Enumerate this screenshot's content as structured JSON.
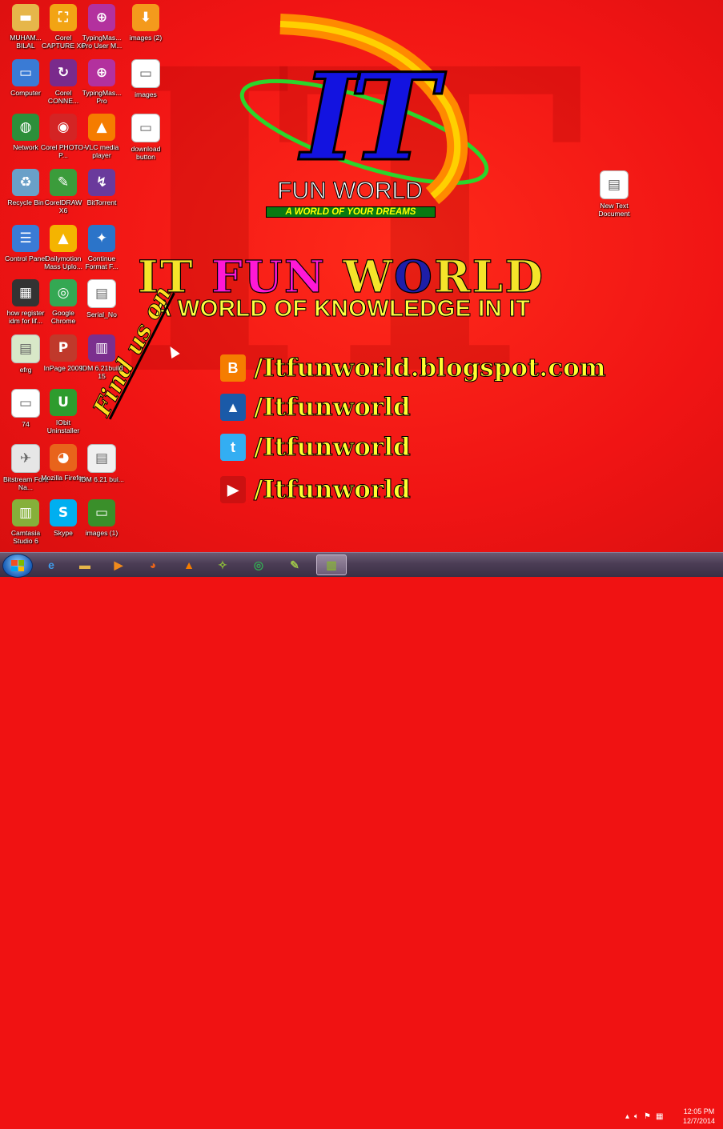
{
  "desktop": {
    "icons": [
      {
        "label": "MUHAM... BILAL",
        "icon": "folder-icon",
        "color": "#e6b64a",
        "glyph": "▬"
      },
      {
        "label": "Corel CAPTURE X6",
        "icon": "corel-capture-icon",
        "color": "#f2a414",
        "glyph": "⛶"
      },
      {
        "label": "TypingMas... Pro User M...",
        "icon": "typingmaster-icon",
        "color": "#b3319e",
        "glyph": "⊕"
      },
      {
        "label": "images (2)",
        "icon": "image-file-icon",
        "color": "#f49a1c",
        "glyph": "⬇"
      },
      {
        "label": "Computer",
        "icon": "computer-icon",
        "color": "#3a7bd5",
        "glyph": "▭"
      },
      {
        "label": "Corel CONNE...",
        "icon": "corel-connect-icon",
        "color": "#7a2a8c",
        "glyph": "↻"
      },
      {
        "label": "TypingMas... Pro",
        "icon": "typingmaster-icon",
        "color": "#b3319e",
        "glyph": "⊕"
      },
      {
        "label": "images",
        "icon": "image-file-icon",
        "color": "#ffffff",
        "glyph": "▭"
      },
      {
        "label": "Network",
        "icon": "network-icon",
        "color": "#2d8f3a",
        "glyph": "◍"
      },
      {
        "label": "Corel PHOTO-P...",
        "icon": "corel-photopaint-icon",
        "color": "#d42424",
        "glyph": "◉"
      },
      {
        "label": "VLC media player",
        "icon": "vlc-icon",
        "color": "#f57c00",
        "glyph": "▲"
      },
      {
        "label": "download button",
        "icon": "image-file-icon",
        "color": "#ffffff",
        "glyph": "▭"
      },
      {
        "label": "Recycle Bin",
        "icon": "recycle-bin-icon",
        "color": "#6aa0c8",
        "glyph": "♻"
      },
      {
        "label": "CorelDRAW X6",
        "icon": "coreldraw-icon",
        "color": "#3b9c3b",
        "glyph": "✎"
      },
      {
        "label": "BitTorrent",
        "icon": "bittorrent-icon",
        "color": "#6a3a9c",
        "glyph": "↯"
      },
      {
        "label": "Control Panel",
        "icon": "control-panel-icon",
        "color": "#3a7bd5",
        "glyph": "☰"
      },
      {
        "label": "Dailymotion Mass Uplo...",
        "icon": "dailymotion-icon",
        "color": "#f4b400",
        "glyph": "▲"
      },
      {
        "label": "Continue Format F...",
        "icon": "format-factory-icon",
        "color": "#2b74c9",
        "glyph": "✦"
      },
      {
        "label": "how register idm for lif...",
        "icon": "video-file-icon",
        "color": "#333333",
        "glyph": "▦"
      },
      {
        "label": "Google Chrome",
        "icon": "chrome-icon",
        "color": "#34a853",
        "glyph": "◎"
      },
      {
        "label": "Serial_No",
        "icon": "text-file-icon",
        "color": "#ffffff",
        "glyph": "▤"
      },
      {
        "label": "efrg",
        "icon": "document-icon",
        "color": "#d8e8c8",
        "glyph": "▤"
      },
      {
        "label": "InPage 2009",
        "icon": "inpage-icon",
        "color": "#c0392b",
        "glyph": "P"
      },
      {
        "label": "IDM 6.21build 15",
        "icon": "winrar-icon",
        "color": "#7b2f8e",
        "glyph": "▥"
      },
      {
        "label": "74",
        "icon": "image-file-icon",
        "color": "#ffffff",
        "glyph": "▭"
      },
      {
        "label": "IObit Uninstaller",
        "icon": "iobit-icon",
        "color": "#2e9c2e",
        "glyph": "U"
      },
      {
        "label": "Bitstream Font Na...",
        "icon": "bitstream-icon",
        "color": "#e6e6e6",
        "glyph": "✈"
      },
      {
        "label": "Mozilla Firefox",
        "icon": "firefox-icon",
        "color": "#e8641b",
        "glyph": "◕"
      },
      {
        "label": "IDM 6.21 bui...",
        "icon": "document-icon",
        "color": "#f0f0f0",
        "glyph": "▤"
      },
      {
        "label": "Camtasia Studio 6",
        "icon": "camtasia-icon",
        "color": "#86b03a",
        "glyph": "▥"
      },
      {
        "label": "Skype",
        "icon": "skype-icon",
        "color": "#00aff0",
        "glyph": "S"
      },
      {
        "label": "images (1)",
        "icon": "image-file-icon",
        "color": "#3a8f2a",
        "glyph": "▭"
      },
      {
        "label": "New Text Document",
        "icon": "text-file-icon",
        "color": "#ffffff",
        "glyph": "▤"
      }
    ],
    "wallpaper": {
      "logo_letters": "IT",
      "logo_name": "FUN WORLD",
      "logo_tagline": "A WORLD OF YOUR DREAMS",
      "title_part1": "IT ",
      "title_part2": "FUN ",
      "title_part3a": "W",
      "title_part3b": "O",
      "title_part3c": "RLD",
      "subtitle": "A WORLD OF KNOWLEDGE IN IT",
      "find_us": "Find us on",
      "social": [
        {
          "icon": "blogger-icon",
          "color": "#f57d00",
          "glyph": "B",
          "text": "/Itfunworld.blogspot.com"
        },
        {
          "icon": "dailymotion-icon",
          "color": "#1a5aa8",
          "glyph": "▲",
          "text": "/Itfunworld"
        },
        {
          "icon": "twitter-icon",
          "color": "#33aef2",
          "glyph": "t",
          "text": "/Itfunworld"
        },
        {
          "icon": "youtube-icon",
          "color": "#cc1111",
          "glyph": "▶",
          "text": "/Itfunworld"
        }
      ]
    }
  },
  "taskbar": {
    "items": [
      {
        "icon": "internet-explorer-icon",
        "glyph": "e",
        "color": "#3f9bea"
      },
      {
        "icon": "file-explorer-icon",
        "glyph": "▬",
        "color": "#e6b64a"
      },
      {
        "icon": "media-player-icon",
        "glyph": "▶",
        "color": "#f08a1c"
      },
      {
        "icon": "firefox-icon",
        "glyph": "◕",
        "color": "#e8641b"
      },
      {
        "icon": "vlc-icon",
        "glyph": "▲",
        "color": "#f57c00"
      },
      {
        "icon": "windows-live-icon",
        "glyph": "✧",
        "color": "#8fbf3a"
      },
      {
        "icon": "chrome-icon",
        "glyph": "◎",
        "color": "#34a853"
      },
      {
        "icon": "corel-icon",
        "glyph": "✎",
        "color": "#9cc24a"
      },
      {
        "icon": "camtasia-icon",
        "glyph": "▥",
        "color": "#86b03a"
      }
    ],
    "clock": {
      "time": "12:05 PM",
      "date": "12/7/2014"
    },
    "tray_icons": [
      "chevron-up-icon",
      "volume-icon",
      "flag-icon",
      "network-icon",
      "action-center-icon"
    ]
  }
}
